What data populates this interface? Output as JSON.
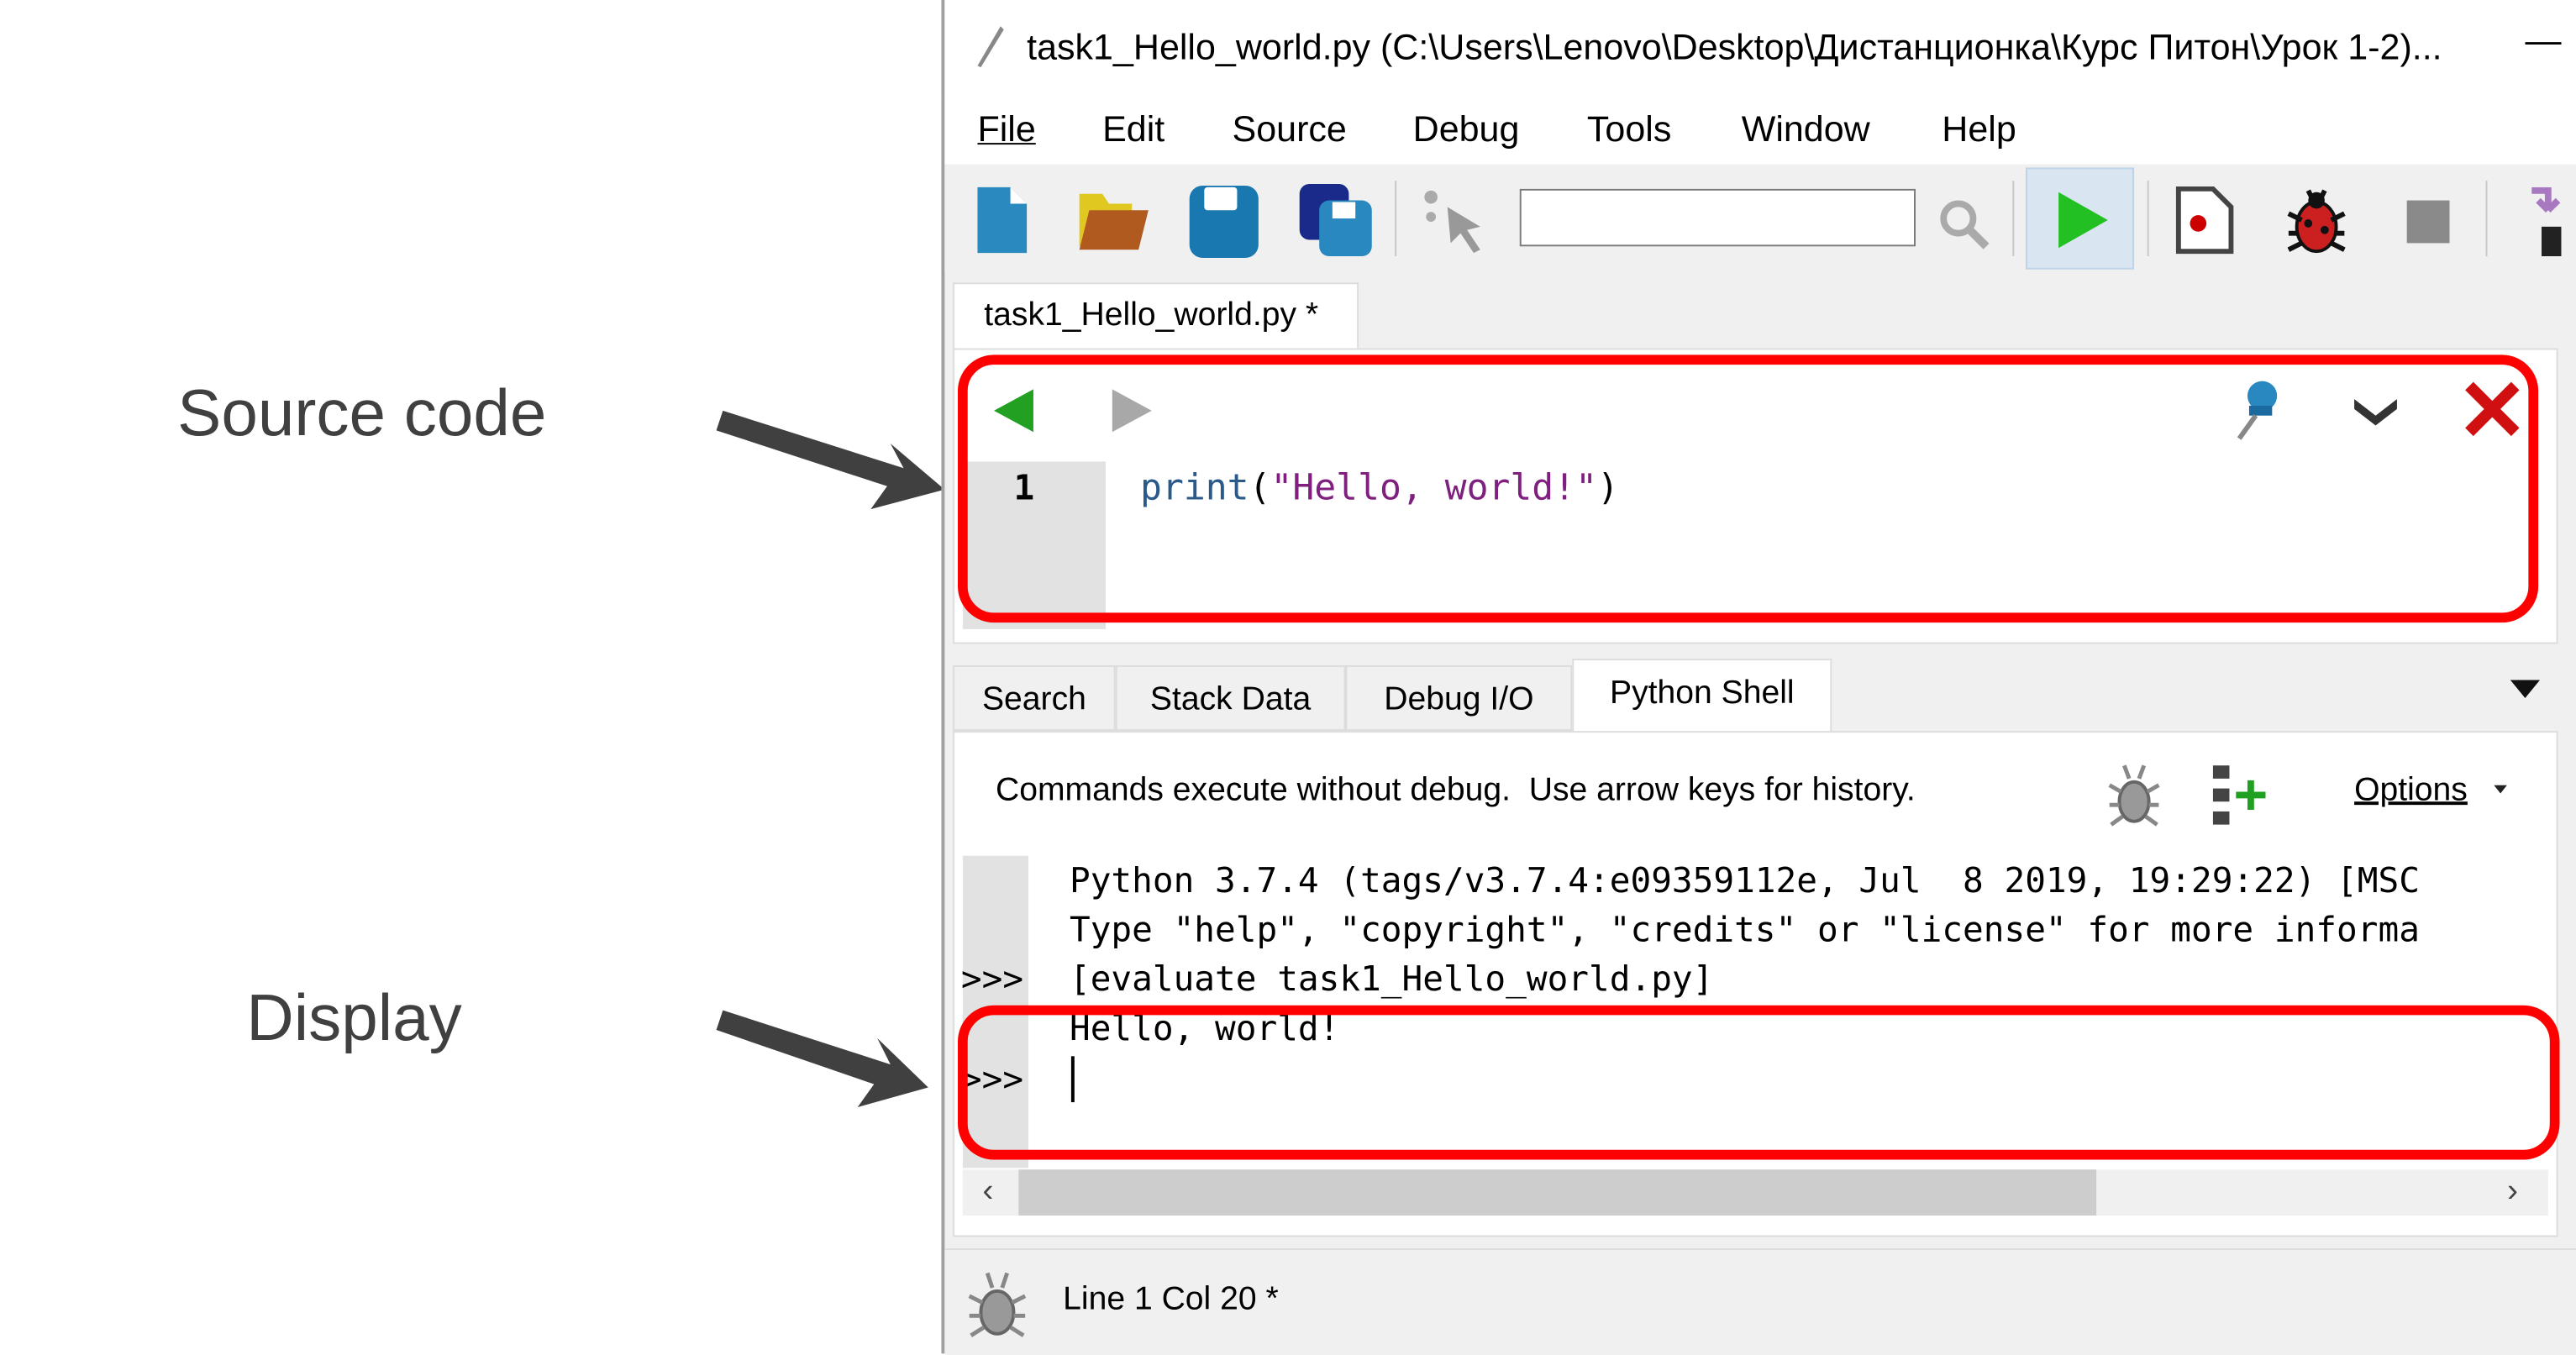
{
  "annotations": {
    "source_code": "Source code",
    "display": "Display"
  },
  "window": {
    "title": "task1_Hello_world.py (C:\\Users\\Lenovo\\Desktop\\Дистанционка\\Курс Питон\\Урок 1-2)...",
    "minimize": "—"
  },
  "menu": [
    {
      "label": "File"
    },
    {
      "label": "Edit"
    },
    {
      "label": "Source"
    },
    {
      "label": "Debug"
    },
    {
      "label": "Tools"
    },
    {
      "label": "Window"
    },
    {
      "label": "Help"
    }
  ],
  "toolbar": {
    "search_value": "",
    "icons": [
      "new-file-icon",
      "open-folder-icon",
      "save-icon",
      "save-all-icon",
      "pointer-icon",
      "search-icon",
      "run-icon",
      "new-breakpoint-icon",
      "debug-bug-icon",
      "stop-icon",
      "step-into-icon"
    ]
  },
  "editor": {
    "tab": "task1_Hello_world.py *",
    "line_number": "1",
    "code": {
      "func": "print",
      "open": "(",
      "string": "\"Hello, world!\"",
      "close": ")"
    }
  },
  "panel": {
    "tabs": [
      {
        "label": "Search"
      },
      {
        "label": "Stack Data"
      },
      {
        "label": "Debug I/O"
      },
      {
        "label": "Python Shell",
        "selected": true
      }
    ],
    "info": "Commands execute without debug.  Use arrow keys for history.",
    "options": "Options",
    "shell_lines": [
      "Python 3.7.4 (tags/v3.7.4:e09359112e, Jul  8 2019, 19:29:22) [MSC",
      "Type \"help\", \"copyright\", \"credits\" or \"license\" for more informa",
      "[evaluate task1_Hello_world.py]",
      "Hello, world!"
    ],
    "prompt": ">>>"
  },
  "status": {
    "text": "Line 1 Col 20 *"
  },
  "colors": {
    "highlight": "#ff0000",
    "run": "#22c022",
    "string": "#7f1f7f",
    "keyword": "#2a5a8a"
  }
}
